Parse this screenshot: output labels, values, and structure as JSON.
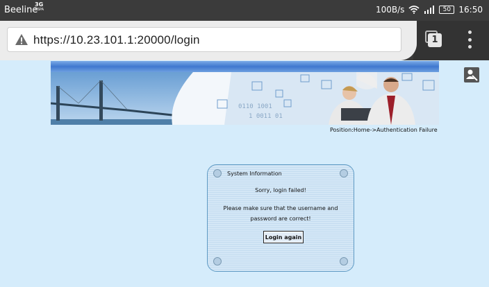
{
  "status_bar": {
    "carrier": "Beeline",
    "network_type": "3G",
    "network_sub": "HSPA",
    "speed": "100B/s",
    "battery": "50",
    "time": "16:50"
  },
  "browser": {
    "url": "https://10.23.101.1:20000/login",
    "tab_count": "1"
  },
  "page": {
    "position": "Position:Home->Authentication Failure",
    "info_title": "System Information",
    "message": "Sorry, login failed!",
    "detail_line1": "Please make sure that the username and",
    "detail_line2": "password are correct!",
    "login_button": "Login again"
  },
  "colors": {
    "page_background": "#d5ecfb",
    "status_bar": "#3b3b3b",
    "banner_bar": "#3f78cf",
    "box_border": "#5e9ac4"
  }
}
